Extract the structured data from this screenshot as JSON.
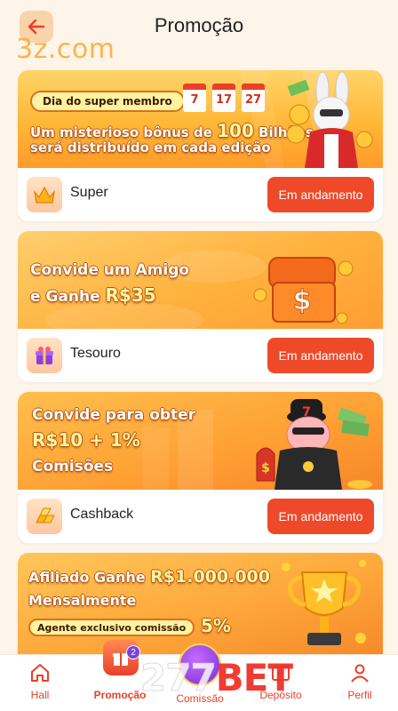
{
  "header": {
    "title": "Promoção",
    "site_logo": "3z.com"
  },
  "colors": {
    "accent": "#ee4a2a",
    "background": "#fdf5ea",
    "nav_active": "#e8402a"
  },
  "cards": [
    {
      "label": "Super",
      "status": "Em andamento",
      "icon": "crown-icon",
      "banner": {
        "pill": "Dia do super membro",
        "dates": [
          "7",
          "17",
          "27"
        ],
        "line1_a": "Um misterioso bônus de ",
        "line1_b": "100",
        "line1_c": " Bilhões",
        "line2": "será distribuído em cada edição"
      }
    },
    {
      "label": "Tesouro",
      "status": "Em andamento",
      "icon": "gift-icon",
      "banner": {
        "line1": "Convide um Amigo",
        "line2_a": "e Ganhe ",
        "line2_b": "R$35"
      }
    },
    {
      "label": "Cashback",
      "status": "Em andamento",
      "icon": "gold-bars-icon",
      "banner": {
        "line1": "Convide para obter",
        "line2": "R$10 + 1%",
        "line3": "Comisões"
      }
    },
    {
      "banner": {
        "line1_a": "Afiliado Ganhe ",
        "line1_b": "R$1.000.000",
        "line2": "Mensalmente",
        "pill": "Agente exclusivo comissão",
        "pill_value": "5%"
      }
    }
  ],
  "bottom_nav": {
    "items": [
      {
        "label": "Hall",
        "icon": "home-icon"
      },
      {
        "label": "Promoção",
        "icon": "gift-icon",
        "badge": "2"
      },
      {
        "label": "Comissão",
        "icon": "coin-icon"
      },
      {
        "label": "Depósito",
        "icon": "wallet-icon"
      },
      {
        "label": "Perfil",
        "icon": "user-icon"
      }
    ]
  },
  "watermark": {
    "num": "277",
    "brand": "BET"
  }
}
